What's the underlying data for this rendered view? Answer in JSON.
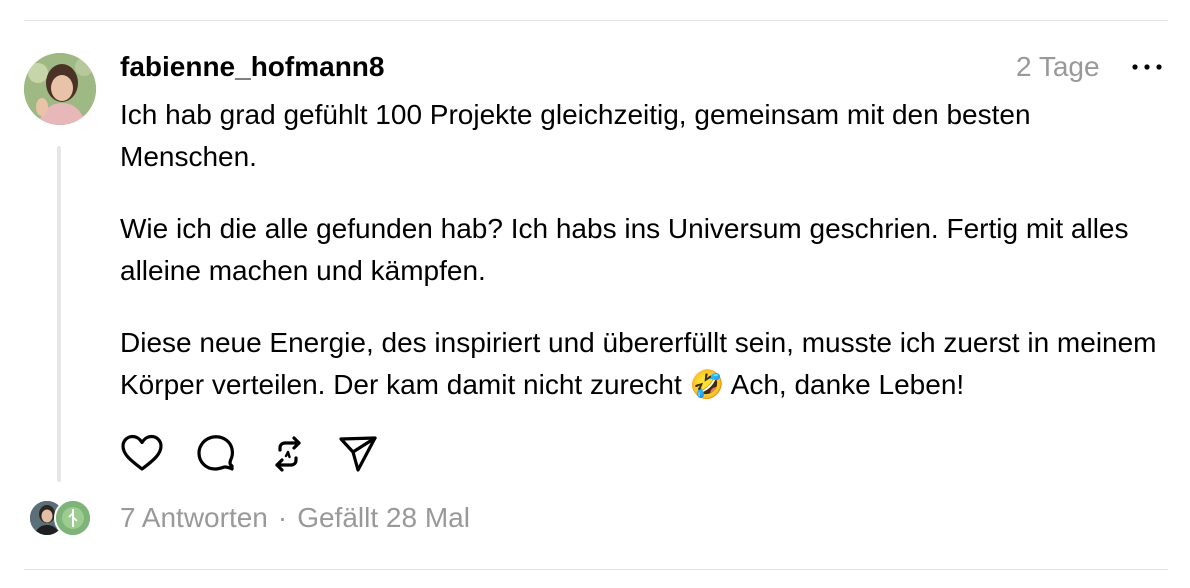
{
  "post": {
    "username": "fabienne_hofmann8",
    "timestamp": "2 Tage",
    "paragraphs": [
      "Ich hab grad gefühlt 100 Projekte gleichzeitig, gemeinsam mit den besten Menschen.",
      "Wie ich die alle gefunden hab? Ich habs ins Universum geschrien. Fertig mit alles alleine machen und kämpfen.",
      "Diese neue Energie, des inspiriert und übererfüllt sein, musste ich zuerst in meinem Körper verteilen. Der kam damit nicht zurecht 🤣 Ach, danke Leben!"
    ]
  },
  "actions": {
    "icons": [
      "heart-icon",
      "comment-icon",
      "repost-icon",
      "share-icon"
    ]
  },
  "footer": {
    "replies": "7 Antworten",
    "separator": "·",
    "likes": "Gefällt 28 Mal"
  },
  "icons": {
    "more": "more-horizontal-icon"
  },
  "colors": {
    "text": "#000000",
    "muted": "#999999",
    "divider": "#e3e3e3",
    "thread_line": "#e6e6e6"
  }
}
